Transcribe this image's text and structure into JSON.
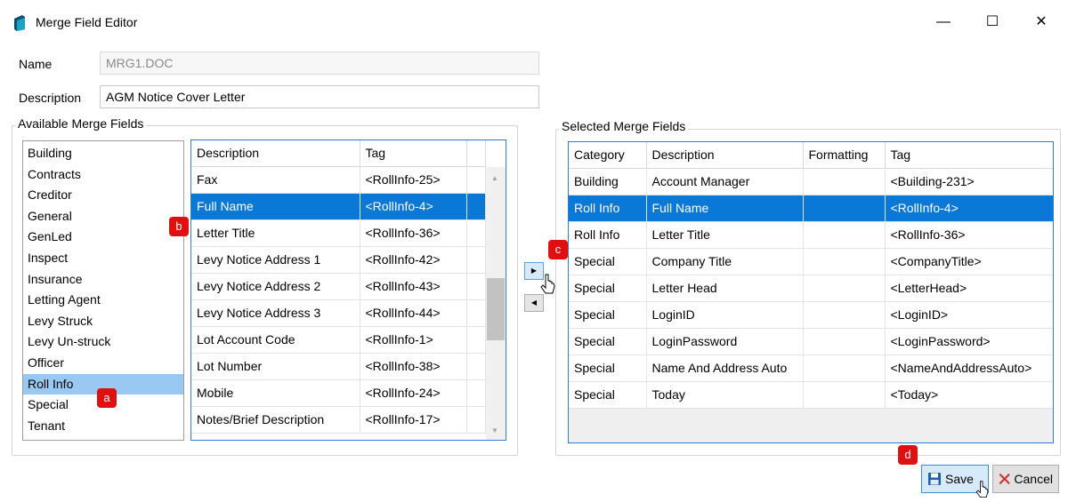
{
  "window": {
    "title": "Merge Field Editor",
    "minimize_glyph": "—",
    "maximize_glyph": "☐",
    "close_glyph": "✕"
  },
  "form": {
    "name_label": "Name",
    "name_value": "MRG1.DOC",
    "description_label": "Description",
    "description_value": "AGM Notice Cover Letter"
  },
  "available": {
    "group_title": "Available Merge Fields",
    "categories": [
      "Building",
      "Contracts",
      "Creditor",
      "General",
      "GenLed",
      "Inspect",
      "Insurance",
      "Letting Agent",
      "Levy Struck",
      "Levy Un-struck",
      "Officer",
      "Roll Info",
      "Special",
      "Tenant"
    ],
    "selected_category": "Roll Info",
    "columns": [
      "Description",
      "Tag"
    ],
    "rows": [
      {
        "description": "Fax",
        "tag": "<RollInfo-25>"
      },
      {
        "description": "Full Name",
        "tag": "<RollInfo-4>",
        "selected": true
      },
      {
        "description": "Letter Title",
        "tag": "<RollInfo-36>"
      },
      {
        "description": "Levy Notice Address 1",
        "tag": "<RollInfo-42>"
      },
      {
        "description": "Levy Notice Address 2",
        "tag": "<RollInfo-43>"
      },
      {
        "description": "Levy Notice Address 3",
        "tag": "<RollInfo-44>"
      },
      {
        "description": "Lot Account Code",
        "tag": "<RollInfo-1>"
      },
      {
        "description": "Lot Number",
        "tag": "<RollInfo-38>"
      },
      {
        "description": "Mobile",
        "tag": "<RollInfo-24>"
      },
      {
        "description": "Notes/Brief Description",
        "tag": "<RollInfo-17>"
      }
    ]
  },
  "move": {
    "add_glyph": "▶",
    "remove_glyph": "◀"
  },
  "selected": {
    "group_title": "Selected Merge Fields",
    "columns": [
      "Category",
      "Description",
      "Formatting",
      "Tag"
    ],
    "rows": [
      {
        "category": "Building",
        "description": "Account Manager",
        "formatting": "",
        "tag": "<Building-231>"
      },
      {
        "category": "Roll Info",
        "description": "Full Name",
        "formatting": "",
        "tag": "<RollInfo-4>",
        "selected": true
      },
      {
        "category": "Roll Info",
        "description": "Letter Title",
        "formatting": "",
        "tag": "<RollInfo-36>"
      },
      {
        "category": "Special",
        "description": "Company Title",
        "formatting": "",
        "tag": "<CompanyTitle>"
      },
      {
        "category": "Special",
        "description": "Letter Head",
        "formatting": "",
        "tag": "<LetterHead>"
      },
      {
        "category": "Special",
        "description": "LoginID",
        "formatting": "",
        "tag": "<LoginID>"
      },
      {
        "category": "Special",
        "description": "LoginPassword",
        "formatting": "",
        "tag": "<LoginPassword>"
      },
      {
        "category": "Special",
        "description": "Name And Address Auto",
        "formatting": "",
        "tag": "<NameAndAddressAuto>"
      },
      {
        "category": "Special",
        "description": "Today",
        "formatting": "",
        "tag": "<Today>"
      }
    ]
  },
  "buttons": {
    "save_label": "Save",
    "cancel_label": "Cancel"
  },
  "callouts": {
    "a": "a",
    "b": "b",
    "c": "c",
    "d": "d"
  },
  "colors": {
    "selection": "#0a78d7",
    "list_selection": "#99c9f3",
    "callout": "#e01010",
    "grid_border": "#2a7fd6"
  }
}
